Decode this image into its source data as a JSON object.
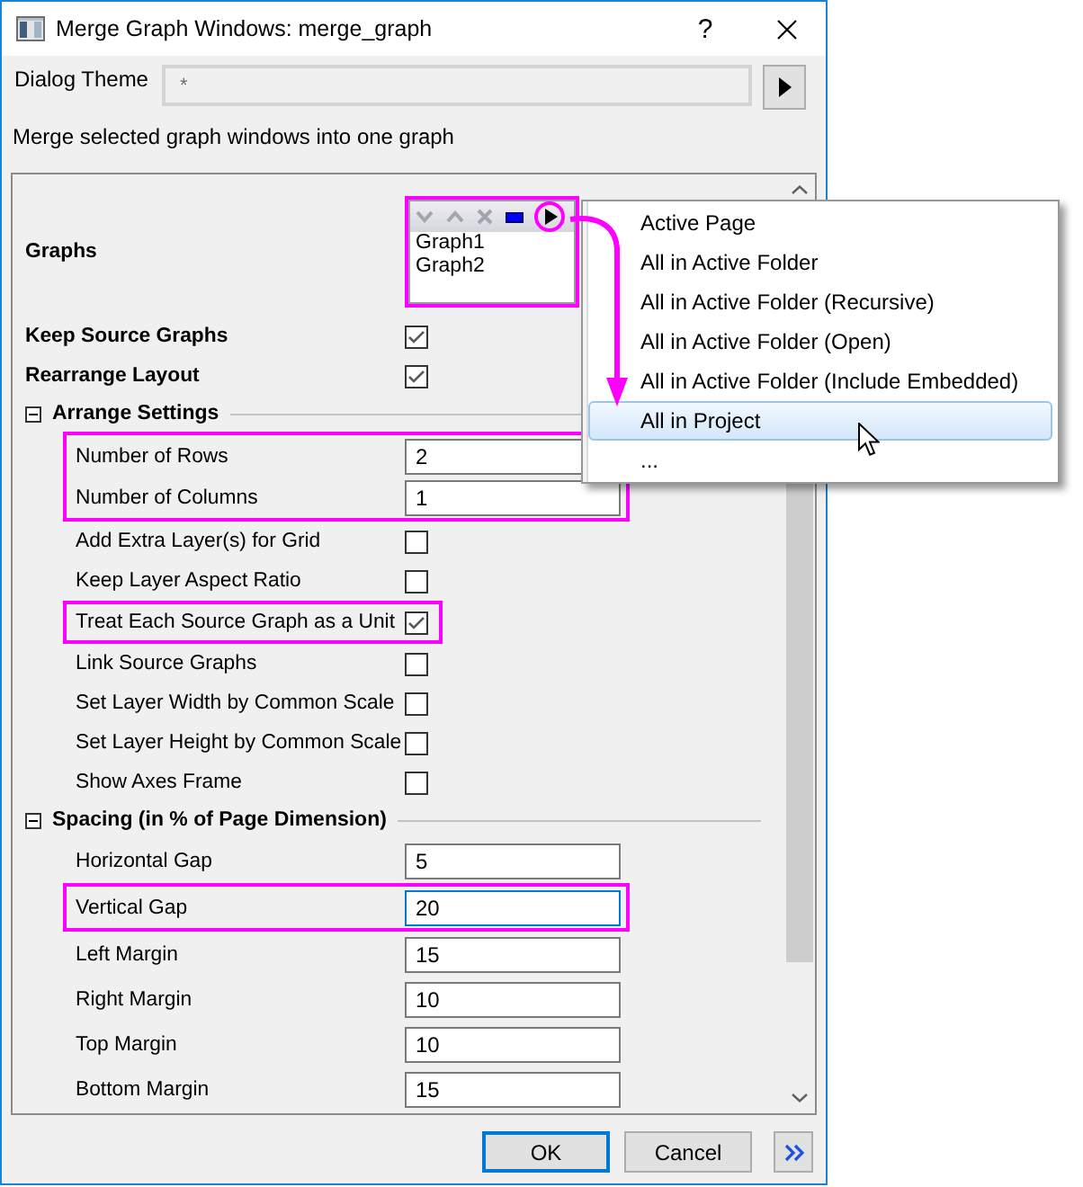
{
  "window": {
    "title": "Merge Graph Windows: merge_graph",
    "help": "?"
  },
  "theme": {
    "label": "Dialog Theme",
    "value": "*",
    "disabled": true
  },
  "description": "Merge selected graph windows into one graph",
  "settings": [
    {
      "kind": "list",
      "label": "Graphs",
      "highlighted": true,
      "toolbar": [
        {
          "kind": "down",
          "disabled": true,
          "highlighted": false
        },
        {
          "kind": "up",
          "disabled": true,
          "highlighted": false
        },
        {
          "kind": "remove",
          "disabled": true,
          "highlighted": false
        },
        {
          "kind": "select",
          "disabled": false,
          "highlighted": false
        },
        {
          "kind": "menu",
          "disabled": false,
          "highlighted": true
        }
      ],
      "items": [
        "Graph1",
        "Graph2"
      ]
    },
    {
      "kind": "checkbox",
      "label": "Keep Source Graphs",
      "checked": true,
      "highlighted": false
    },
    {
      "kind": "checkbox",
      "label": "Rearrange Layout",
      "checked": true,
      "highlighted": false
    },
    {
      "kind": "section",
      "label": "Arrange Settings",
      "expanded": true,
      "highlighted": false,
      "children": [
        {
          "kind": "input",
          "label": "Number of Rows",
          "value": "2",
          "focused": false,
          "highlighted": true
        },
        {
          "kind": "input",
          "label": "Number of Columns",
          "value": "1",
          "focused": false,
          "highlighted": true
        },
        {
          "kind": "checkbox",
          "label": "Add Extra Layer(s) for Grid",
          "checked": false,
          "highlighted": false
        },
        {
          "kind": "checkbox",
          "label": "Keep Layer Aspect Ratio",
          "checked": false,
          "highlighted": false
        },
        {
          "kind": "checkbox",
          "label": "Treat Each Source Graph as a Unit",
          "checked": true,
          "highlighted": true
        },
        {
          "kind": "checkbox",
          "label": "Link Source Graphs",
          "checked": false,
          "highlighted": false
        },
        {
          "kind": "checkbox",
          "label": "Set Layer Width by Common Scale",
          "checked": false,
          "highlighted": false
        },
        {
          "kind": "checkbox",
          "label": "Set Layer Height by Common Scale",
          "checked": false,
          "highlighted": false
        },
        {
          "kind": "checkbox",
          "label": "Show Axes Frame",
          "checked": false,
          "highlighted": false
        }
      ]
    },
    {
      "kind": "section",
      "label": "Spacing (in % of Page Dimension)",
      "expanded": true,
      "highlighted": false,
      "children": [
        {
          "kind": "input",
          "label": "Horizontal Gap",
          "value": "5",
          "focused": false,
          "highlighted": false
        },
        {
          "kind": "input",
          "label": "Vertical Gap",
          "value": "20",
          "focused": true,
          "highlighted": true
        },
        {
          "kind": "input",
          "label": "Left Margin",
          "value": "15",
          "focused": false,
          "highlighted": false
        },
        {
          "kind": "input",
          "label": "Right Margin",
          "value": "10",
          "focused": false,
          "highlighted": false
        },
        {
          "kind": "input",
          "label": "Top Margin",
          "value": "10",
          "focused": false,
          "highlighted": false
        },
        {
          "kind": "input",
          "label": "Bottom Margin",
          "value": "15",
          "focused": false,
          "highlighted": false
        }
      ]
    }
  ],
  "menu": {
    "items": [
      {
        "label": "Active Page",
        "selected": false
      },
      {
        "label": "All in Active Folder",
        "selected": false
      },
      {
        "label": "All in Active Folder (Recursive)",
        "selected": false
      },
      {
        "label": "All in Active Folder (Open)",
        "selected": false
      },
      {
        "label": "All in Active Folder (Include Embedded)",
        "selected": false
      },
      {
        "label": "All in Project",
        "selected": true
      },
      {
        "label": "...",
        "selected": false
      }
    ]
  },
  "buttons": [
    {
      "label": "OK",
      "default": true
    },
    {
      "label": "Cancel",
      "default": false
    }
  ]
}
